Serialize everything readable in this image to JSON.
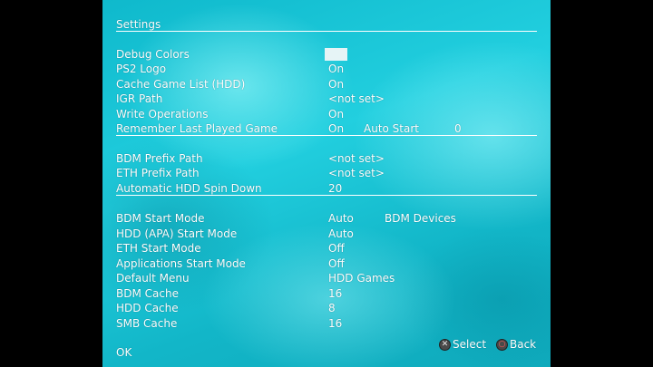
{
  "title": "Settings",
  "group1": [
    {
      "label": "Debug Colors",
      "value": ""
    },
    {
      "label": "PS2 Logo",
      "value": "On"
    },
    {
      "label": "Cache Game List (HDD)",
      "value": "On"
    },
    {
      "label": "IGR Path",
      "value": "<not set>"
    },
    {
      "label": "Write Operations",
      "value": "On"
    },
    {
      "label": "Remember Last Played Game",
      "value": "On",
      "extra_label": "Auto Start",
      "extra_value": "0"
    }
  ],
  "group2": [
    {
      "label": "BDM Prefix Path",
      "value": "<not set>"
    },
    {
      "label": "ETH Prefix Path",
      "value": "<not set>"
    },
    {
      "label": "Automatic HDD Spin Down",
      "value": "20"
    }
  ],
  "group3": [
    {
      "label": "BDM Start Mode",
      "value": "Auto",
      "extra_label": "BDM Devices"
    },
    {
      "label": "HDD (APA) Start Mode",
      "value": "Auto"
    },
    {
      "label": "ETH Start Mode",
      "value": "Off"
    },
    {
      "label": "Applications Start Mode",
      "value": "Off"
    },
    {
      "label": "Default Menu",
      "value": "HDD Games"
    },
    {
      "label": "BDM Cache",
      "value": "16"
    },
    {
      "label": "HDD Cache",
      "value": "8"
    },
    {
      "label": "SMB Cache",
      "value": "16"
    }
  ],
  "footer": {
    "ok_label": "OK",
    "select_icon": "cross-button-icon",
    "select_label": "Select",
    "back_icon": "circle-button-icon",
    "back_label": "Back"
  },
  "colors": {
    "background": "#1ec4d6",
    "text": "#ffffff",
    "debug_swatch": "#e6f4f6"
  }
}
